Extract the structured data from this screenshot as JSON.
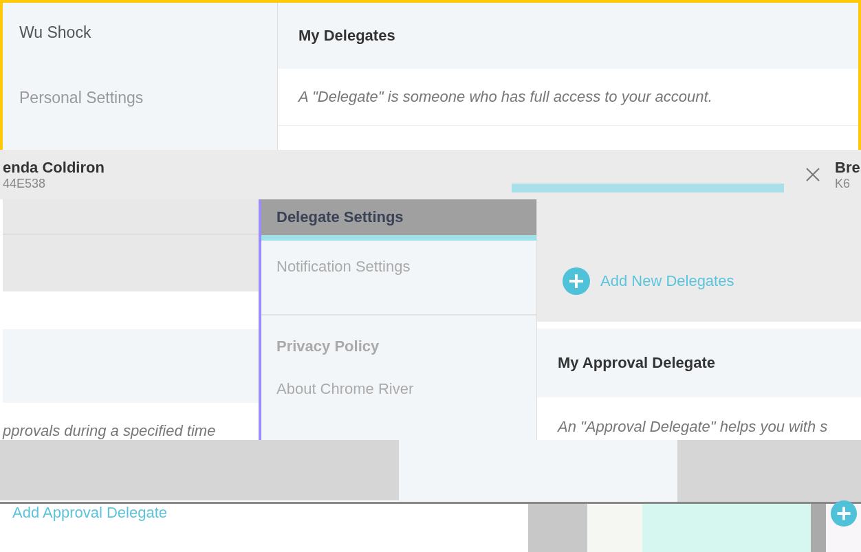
{
  "top_panel": {
    "user_name": "Wu Shock",
    "nav_item": "Personal Settings",
    "section_title": "My Delegates",
    "description": "A \"Delegate\" is someone who has full access to your account."
  },
  "header_bar": {
    "left_name": "enda Coldiron",
    "left_code": "44E538",
    "right_name": "Bre",
    "right_code": "K6"
  },
  "left_strip": {
    "description": "pprovals during a specified time"
  },
  "settings_menu": [
    {
      "label": "Delegate Settings",
      "selected": true
    },
    {
      "label": "Notification Settings",
      "selected": false
    }
  ],
  "links": [
    {
      "label": "Privacy Policy",
      "kind": "heading"
    },
    {
      "label": "About Chrome River",
      "kind": "link"
    }
  ],
  "delegates_panel": {
    "add_link": "Add New Delegates",
    "section_title": "My Approval Delegate",
    "description": "An \"Approval Delegate\" helps you with s"
  },
  "bottom": {
    "add_link": "Add Approval Delegate"
  }
}
